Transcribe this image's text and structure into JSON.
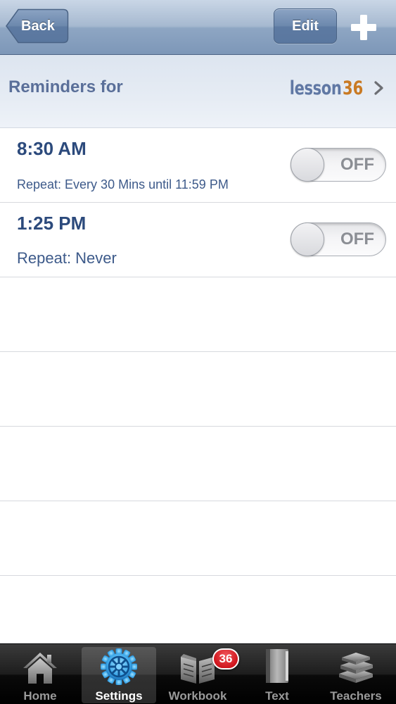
{
  "navbar": {
    "back_label": "Back",
    "edit_label": "Edit",
    "add_icon": "plus-icon"
  },
  "header": {
    "title": "Reminders for",
    "lesson_word": "lesson",
    "lesson_number": "36"
  },
  "reminders": [
    {
      "time": "8:30 AM",
      "repeat": "Repeat: Every 30 Mins until 11:59 PM",
      "toggle_label": "OFF",
      "enabled": false
    },
    {
      "time": "1:25 PM",
      "repeat": "Repeat: Never",
      "toggle_label": "OFF",
      "enabled": false
    }
  ],
  "tabbar": {
    "tabs": [
      {
        "label": "Home",
        "icon": "home-icon",
        "selected": false
      },
      {
        "label": "Settings",
        "icon": "gear-icon",
        "selected": true
      },
      {
        "label": "Workbook",
        "icon": "open-book-icon",
        "selected": false,
        "badge": "36"
      },
      {
        "label": "Text",
        "icon": "closed-book-icon",
        "selected": false
      },
      {
        "label": "Teachers",
        "icon": "stacked-books-icon",
        "selected": false
      }
    ]
  },
  "colors": {
    "navbar": "#8ea6c3",
    "title_text": "#5a6f99",
    "lesson_number": "#c97a23",
    "time_text": "#2c4a7c",
    "badge": "#d0161e"
  }
}
